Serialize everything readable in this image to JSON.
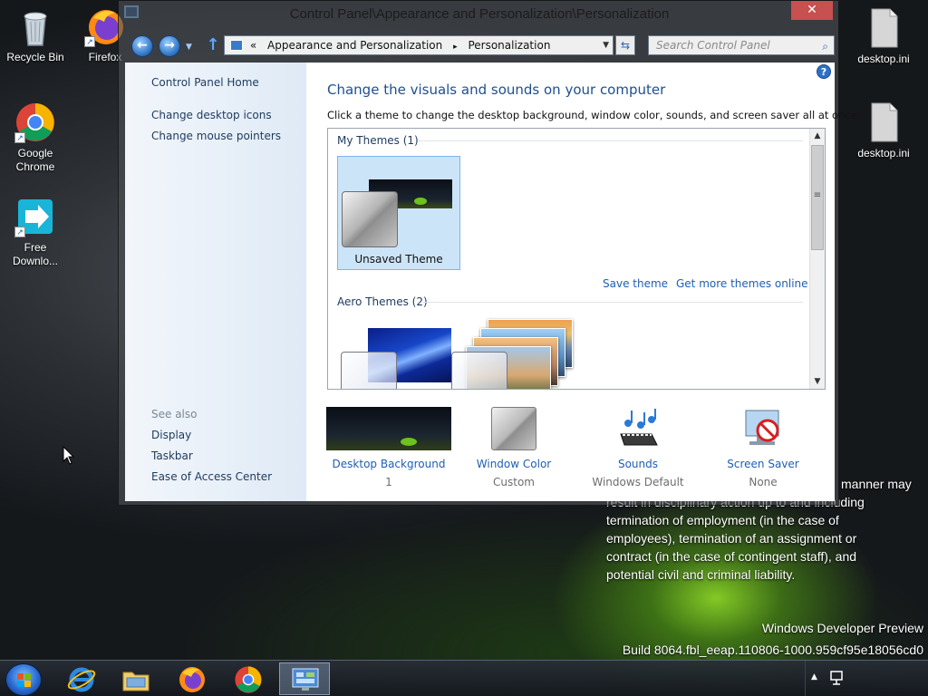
{
  "desktop": {
    "icons": [
      {
        "label": "Recycle Bin"
      },
      {
        "label": "Firefox"
      },
      {
        "label": "Google Chrome"
      },
      {
        "label": "Free Downlo..."
      },
      {
        "label": "desktop.ini"
      },
      {
        "label": "desktop.ini"
      }
    ],
    "notice_first_line": "manner may",
    "notice_lines": [
      "result in disciplinary action up to and including",
      "termination of employment (in the case of",
      "employees), termination of an assignment or",
      "contract (in the case of contingent staff), and",
      "potential civil and criminal liability."
    ],
    "watermark_line1": "Windows Developer Preview",
    "watermark_line2": "Build 8064.fbl_eeap.110806-1000.959cf95e18056cd0"
  },
  "window": {
    "title": "Control Panel\\Appearance and Personalization\\Personalization",
    "close_label": "✕",
    "nav": {
      "back_label": "←",
      "forward_label": "→",
      "dropdown_label": "▼",
      "up_label": "↑",
      "address_prefix": "«",
      "breadcrumb": [
        "Appearance and Personalization",
        "Personalization"
      ],
      "breadcrumb_separator": "▸",
      "address_drop": "▼",
      "refresh_label": "⇆",
      "search_placeholder": "Search Control Panel",
      "search_icon": "⌕"
    },
    "left_pane": {
      "home_link": "Control Panel Home",
      "links": [
        "Change desktop icons",
        "Change mouse pointers"
      ],
      "see_also_label": "See also",
      "see_also_links": [
        "Display",
        "Taskbar",
        "Ease of Access Center"
      ]
    },
    "help_label": "?",
    "main": {
      "heading": "Change the visuals and sounds on your computer",
      "subtext": "Click a theme to change the desktop background, window color, sounds, and screen saver all at once.",
      "groups": [
        {
          "label": "My Themes (1)",
          "themes": [
            {
              "name": "Unsaved Theme",
              "selected": true
            }
          ]
        },
        {
          "label": "Aero Themes (2)",
          "themes": []
        }
      ],
      "save_theme_link": "Save theme",
      "more_themes_link": "Get more themes online",
      "scroll": {
        "up": "▲",
        "down": "▼",
        "grip": "≡"
      }
    },
    "bottom": [
      {
        "link": "Desktop Background",
        "sub": "1",
        "icon": "desktop-background-thumbnail"
      },
      {
        "link": "Window Color",
        "sub": "Custom",
        "icon": "window-color-swatch"
      },
      {
        "link": "Sounds",
        "sub": "Windows Default",
        "icon": "sounds-icon"
      },
      {
        "link": "Screen Saver",
        "sub": "None",
        "icon": "screen-saver-icon"
      }
    ]
  },
  "taskbar": {
    "items": [
      "Internet Explorer",
      "Windows Explorer",
      "Firefox",
      "Google Chrome",
      "Control Panel"
    ],
    "active_index": 4,
    "tray_up": "▲"
  },
  "colors": {
    "accent_link": "#1e5fb4",
    "heading": "#1e4f8f",
    "close": "#c75050",
    "selection": "#cce4f7"
  }
}
